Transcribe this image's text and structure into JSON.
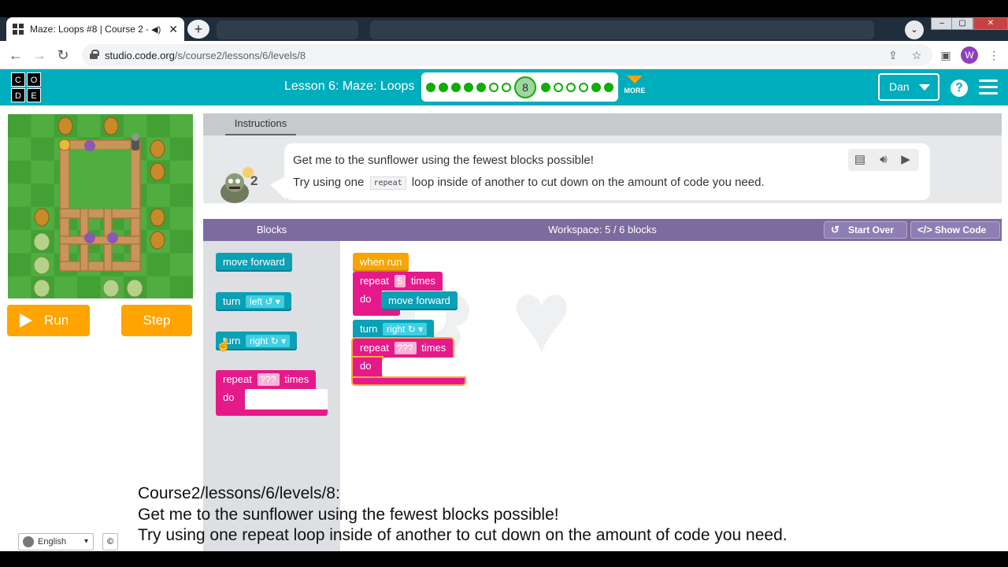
{
  "browser": {
    "tab_title": "Maze: Loops #8 | Course 2 -",
    "url_host": "studio.code.org",
    "url_path": "/s/course2/lessons/6/levels/8",
    "profile_initial": "W"
  },
  "header": {
    "logo_letters": [
      "C",
      "O",
      "D",
      "E"
    ],
    "lesson_title": "Lesson 6: Maze: Loops",
    "current_level": "8",
    "more_label": "MORE",
    "user_name": "Dan",
    "help_label": "?"
  },
  "controls": {
    "run_label": "Run",
    "step_label": "Step"
  },
  "instructions": {
    "tab_label": "Instructions",
    "line1": "Get me to the sunflower using the fewest blocks possible!",
    "line2_pre": "Try using one",
    "line2_code": "repeat",
    "line2_post": "loop inside of another to cut down on the amount of code you need.",
    "badge_number": "2"
  },
  "workspace": {
    "blocks_label": "Blocks",
    "workspace_label": "Workspace: 5 / 6 blocks",
    "start_over_label": "Start Over",
    "show_code_label": "Show Code"
  },
  "toolbox_blocks": {
    "move_forward": "move forward",
    "turn": "turn",
    "left": "left ↺ ▾",
    "right": "right ↻ ▾",
    "repeat": "repeat",
    "unknown": "???",
    "times": "times",
    "do": "do"
  },
  "program": {
    "when_run": "when run",
    "repeat_count": "5",
    "move_forward": "move forward",
    "turn_dir": "right ↻ ▾",
    "inner_count": "???"
  },
  "caption": {
    "line1": "Course2/lessons/6/levels/8:",
    "line2": "Get me to the sunflower using the fewest blocks possible!",
    "line3": "Try using one repeat loop inside of another to cut down on the amount of code you need."
  },
  "footer": {
    "language": "English",
    "copyright_symbol": "©"
  },
  "colors": {
    "header_teal": "#00adbc",
    "run_orange": "#ffa400",
    "block_teal": "#0aa0b6",
    "block_pink": "#e6198a",
    "block_orange": "#f7a500",
    "workspace_purple": "#7d6ba0"
  },
  "icons": [
    "favicon-grid-icon",
    "audio-icon",
    "close-icon",
    "new-tab-icon",
    "back-icon",
    "forward-icon",
    "reload-icon",
    "lock-icon",
    "share-icon",
    "star-icon",
    "sidebar-icon",
    "menu-dots-icon",
    "play-icon",
    "speaker-icon",
    "immersive-reader-icon",
    "start-over-icon",
    "show-code-icon",
    "globe-icon",
    "hand-cursor-icon"
  ]
}
